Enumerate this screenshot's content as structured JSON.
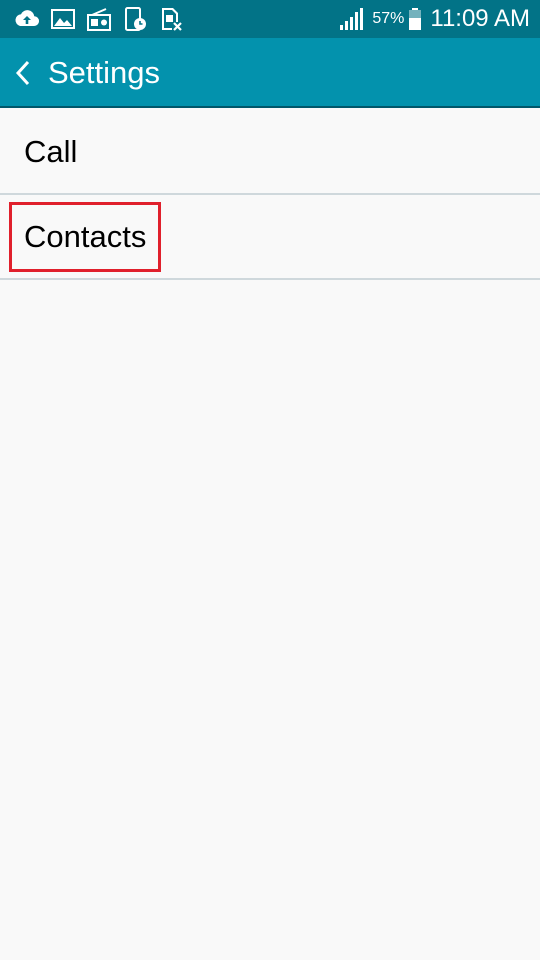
{
  "status_bar": {
    "notification_icons": [
      "upload-cloud-icon",
      "image-icon",
      "radio-icon",
      "phone-clock-icon",
      "sim-x-icon"
    ],
    "signal_icon": "signal-bars-icon",
    "battery_percent": "57%",
    "battery_icon": "battery-icon",
    "time": "11:09 AM"
  },
  "app_bar": {
    "back_icon": "chevron-left-icon",
    "title": "Settings"
  },
  "list": {
    "items": [
      {
        "label": "Call"
      },
      {
        "label": "Contacts",
        "highlighted": true
      }
    ]
  },
  "colors": {
    "status_bar_bg": "#027387",
    "app_bar_bg": "#0392ad",
    "page_bg": "#f9f9f9",
    "divider": "#cfd8dc",
    "highlight_border": "#e0202c"
  }
}
